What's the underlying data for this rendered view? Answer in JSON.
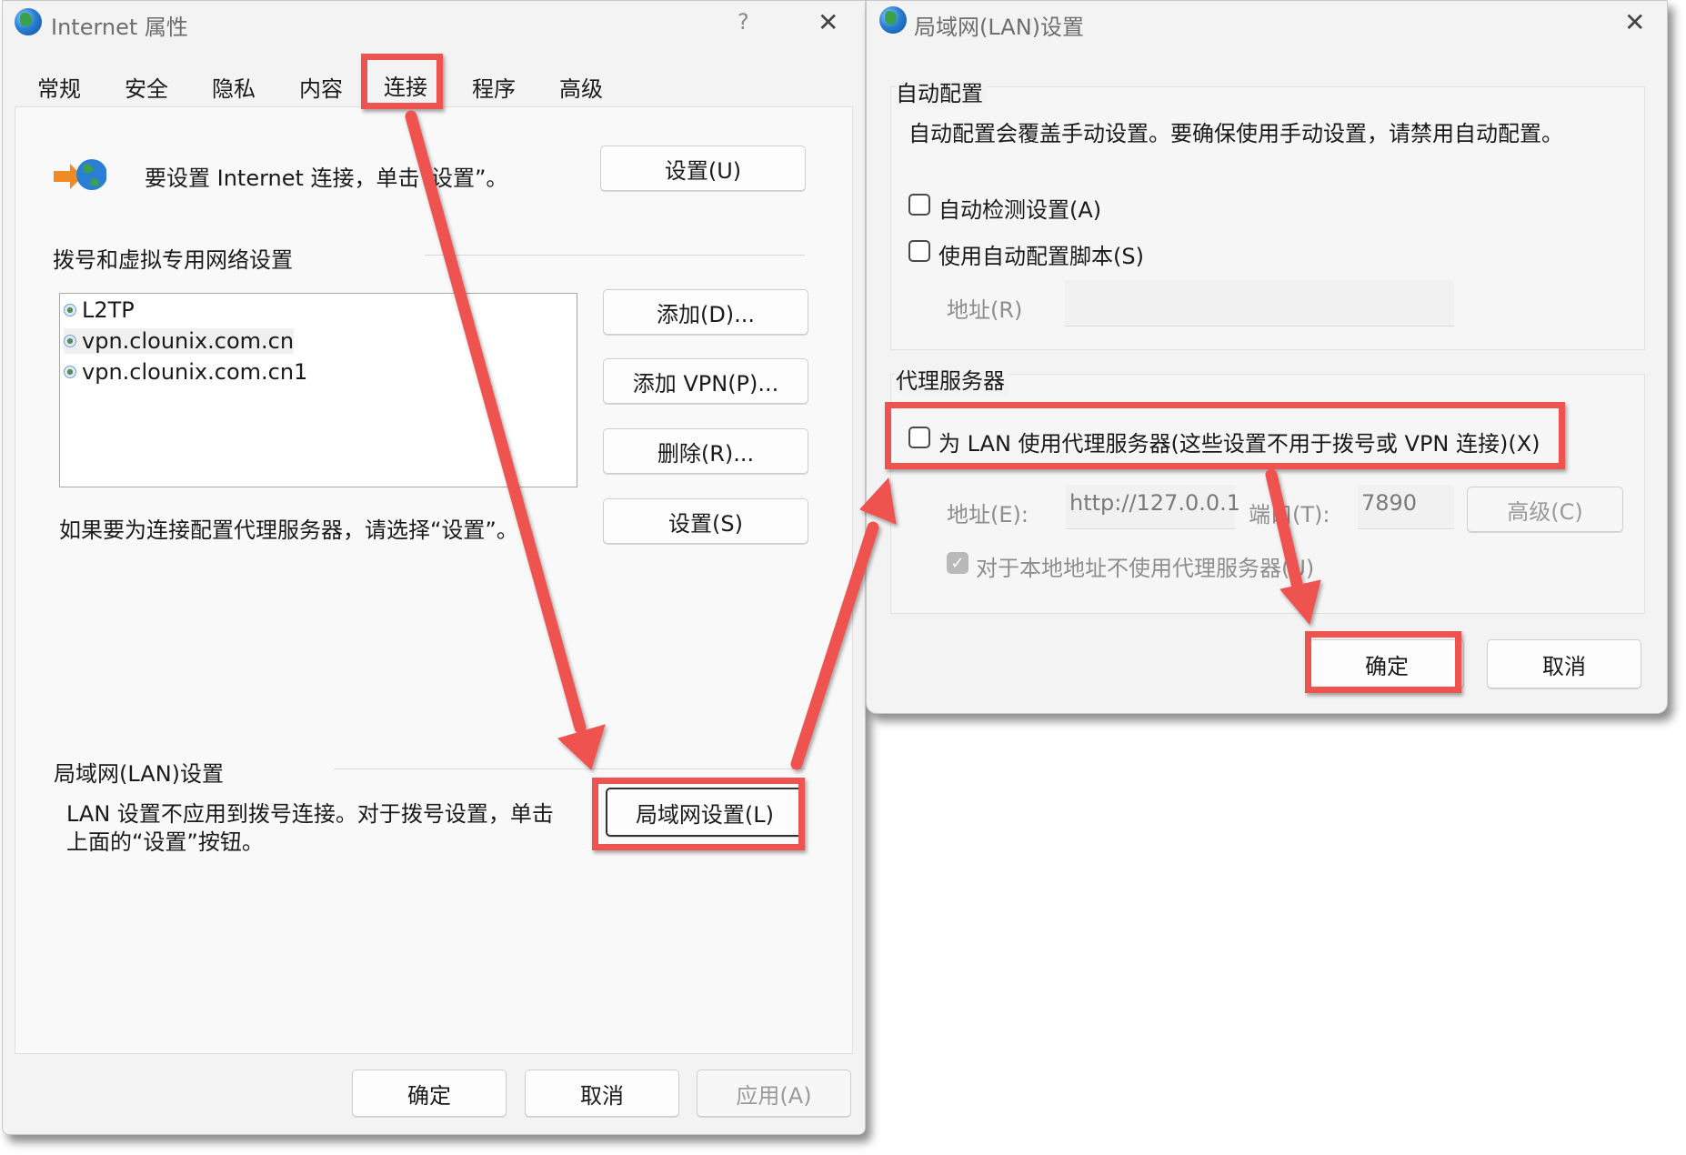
{
  "internet_options": {
    "title": "Internet 属性",
    "help": "?",
    "close": "✕",
    "tabs": [
      "常规",
      "安全",
      "隐私",
      "内容",
      "连接",
      "程序",
      "高级"
    ],
    "setup_text": "要设置 Internet 连接，单击“设置”。",
    "setup_button": "设置(U)",
    "dialup_section": "拨号和虚拟专用网络设置",
    "connections": [
      "L2TP",
      "vpn.clounix.com.cn",
      "vpn.clounix.com.cn1"
    ],
    "add_button": "添加(D)...",
    "add_vpn_button": "添加 VPN(P)...",
    "remove_button": "删除(R)...",
    "settings_button": "设置(S)",
    "proxy_hint": "如果要为连接配置代理服务器，请选择“设置”。",
    "lan_section": "局域网(LAN)设置",
    "lan_desc_line1": "LAN 设置不应用到拨号连接。对于拨号设置，单击",
    "lan_desc_line2": "上面的“设置”按钮。",
    "lan_button": "局域网设置(L)",
    "ok": "确定",
    "cancel": "取消",
    "apply": "应用(A)"
  },
  "lan_dialog": {
    "title": "局域网(LAN)设置",
    "close": "✕",
    "auto_section": "自动配置",
    "auto_desc": "自动配置会覆盖手动设置。要确保使用手动设置，请禁用自动配置。",
    "auto_detect": "自动检测设置(A)",
    "use_script": "使用自动配置脚本(S)",
    "script_address_label": "地址(R)",
    "proxy_section": "代理服务器",
    "use_proxy": "为 LAN 使用代理服务器(这些设置不用于拨号或 VPN 连接)(X)",
    "address_label": "地址(E):",
    "address_value": "http://127.0.0.1",
    "port_label": "端口(T):",
    "port_value": "7890",
    "advanced_button": "高级(C)",
    "bypass_local": "对于本地地址不使用代理服务器(U)",
    "ok": "确定",
    "cancel": "取消"
  },
  "colors": {
    "highlight": "#ef5350",
    "window_bg": "#f3f3f3"
  }
}
